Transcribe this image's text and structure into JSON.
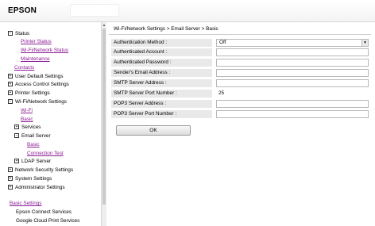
{
  "header": {
    "logo": "EPSON"
  },
  "sidebar": {
    "status": "Status",
    "printer_status": "Printer Status",
    "wifi_network_status": "Wi-Fi/Network Status",
    "maintenance": "Maintenance",
    "contacts": "Contacts",
    "user_default_settings": "User Default Settings",
    "access_control_settings": "Access Control Settings",
    "printer_settings": "Printer Settings",
    "wifi_network_settings": "Wi-Fi/Network Settings",
    "wifi": "Wi-Fi",
    "basic_network": "Basic",
    "services": "Services",
    "email_server": "Email Server",
    "email_basic": "Basic",
    "connection_test": "Connection Test",
    "ldap_server": "LDAP Server",
    "network_security_settings": "Network Security Settings",
    "system_settings": "System Settings",
    "administrator_settings": "Administrator Settings",
    "basic_settings": "Basic Settings",
    "epson_connect_services": "Epson Connect Services",
    "google_cloud_print_services": "Google Cloud Print Services",
    "toggle_minus": "−",
    "toggle_plus": "+"
  },
  "main": {
    "breadcrumb": "Wi-Fi/Network Settings > Email Server > Basic",
    "fields": {
      "auth_method_label": "Authentication Method :",
      "auth_method_value": "Off",
      "auth_account_label": "Authenticated Account :",
      "auth_account_value": "",
      "auth_password_label": "Authenticated Password :",
      "auth_password_value": "",
      "sender_email_label": "Sender's Email Address :",
      "sender_email_value": "",
      "smtp_address_label": "SMTP Server Address :",
      "smtp_address_value": "",
      "smtp_port_label": "SMTP Server Port Number :",
      "smtp_port_value": "25",
      "pop3_address_label": "POP3 Server Address :",
      "pop3_address_value": "",
      "pop3_port_label": "POP3 Server Port Number :",
      "pop3_port_value": ""
    },
    "ok_label": "OK"
  },
  "icons": {
    "dropdown": "chevron-down-icon",
    "scroll_up": "scroll-up-icon"
  }
}
